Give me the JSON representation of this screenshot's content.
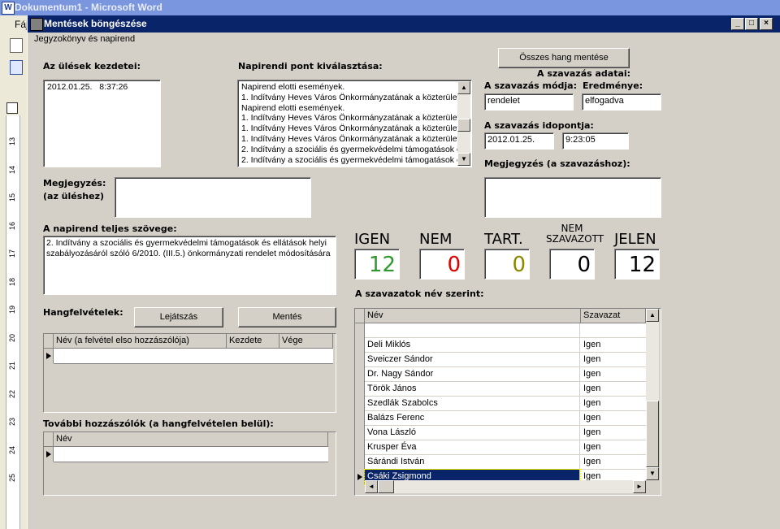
{
  "word": {
    "title": "Dokumentum1 - Microsoft Word",
    "menu_first": "Fáj"
  },
  "ruler": {
    "numbers": [
      "13",
      "14",
      "15",
      "16",
      "17",
      "18",
      "19",
      "20",
      "21",
      "22",
      "23",
      "24",
      "25"
    ]
  },
  "dialog": {
    "title": "Mentések böngészése",
    "menu": "Jegyzokönyv és napirend",
    "sessions_label": "Az ülések kezdetei:",
    "sessions": [
      {
        "date": "2012.01.25.",
        "time": "8:37:26"
      }
    ],
    "agenda_label": "Napirendi pont kiválasztása:",
    "agenda_items": [
      "Napirend elotti események.",
      "1. Indítvány Heves Város Önkormányzatának a közterülete",
      "Napirend elotti események.",
      "1. Indítvány Heves Város Önkormányzatának a közterülete",
      "1. Indítvány Heves Város Önkormányzatának a közterülete",
      "1. Indítvány Heves Város Önkormányzatának a közterülete",
      "2. Indítvány a szociális és gyermekvédelmi támogatások é",
      "2. Indítvány a szociális és gyermekvédelmi támogatások é"
    ],
    "save_all_button": "Összes hang mentése",
    "vote_data_label": "A szavazás adatai:",
    "vote_mode_label": "A szavazás módja:",
    "vote_mode_value": "rendelet",
    "result_label": "Eredménye:",
    "result_value": "elfogadva",
    "vote_time_label": "A szavazás idopontja:",
    "vote_date_value": "2012.01.25.",
    "vote_time_value": "9:23:05",
    "vote_note_label": "Megjegyzés (a szavazáshoz):",
    "session_note_label1": "Megjegyzés:",
    "session_note_label2": "(az üléshez)",
    "full_text_label": "A napirend teljes szövege:",
    "full_text": "2. Indítvány a szociális és gyermekvédelmi támogatások és ellátások helyi szabályozásáról szóló 6/2010. (III.5.) önkormányzati rendelet módosítására",
    "recordings_label": "Hangfelvételek:",
    "play_button": "Lejátszás",
    "save_button": "Mentés",
    "recordings_columns": [
      "Név (a felvétel elso hozzászólója)",
      "Kezdete",
      "Vége"
    ],
    "extra_speakers_label": "További hozzászólók (a hangfelvételen belül):",
    "extra_speakers_columns": [
      "Név"
    ],
    "votes": [
      {
        "label": "IGEN",
        "value": "12",
        "color": "#2e9a2e"
      },
      {
        "label": "NEM",
        "value": "0",
        "color": "#e00000"
      },
      {
        "label": "TART.",
        "value": "0",
        "color": "#8a8a00"
      },
      {
        "label": "NEM SZAVAZOTT",
        "value": "0",
        "color": "#000000"
      },
      {
        "label": "JELEN",
        "value": "12",
        "color": "#000000"
      }
    ],
    "names_label": "A szavazatok név szerint:",
    "names_columns": [
      "Név",
      "Szavazat"
    ],
    "names_rows": [
      {
        "name": "",
        "vote": ""
      },
      {
        "name": "Deli Miklós",
        "vote": "Igen"
      },
      {
        "name": "Sveiczer Sándor",
        "vote": "Igen"
      },
      {
        "name": "Dr. Nagy Sándor",
        "vote": "Igen"
      },
      {
        "name": "Török János",
        "vote": "Igen"
      },
      {
        "name": "Szedlák Szabolcs",
        "vote": "Igen"
      },
      {
        "name": "Balázs Ferenc",
        "vote": "Igen"
      },
      {
        "name": "Vona László",
        "vote": "Igen"
      },
      {
        "name": "Krusper Éva",
        "vote": "Igen"
      },
      {
        "name": "Sárándi István",
        "vote": "Igen"
      },
      {
        "name": "Csáki Zsigmond",
        "vote": "Igen"
      }
    ],
    "selected_row": 10
  }
}
